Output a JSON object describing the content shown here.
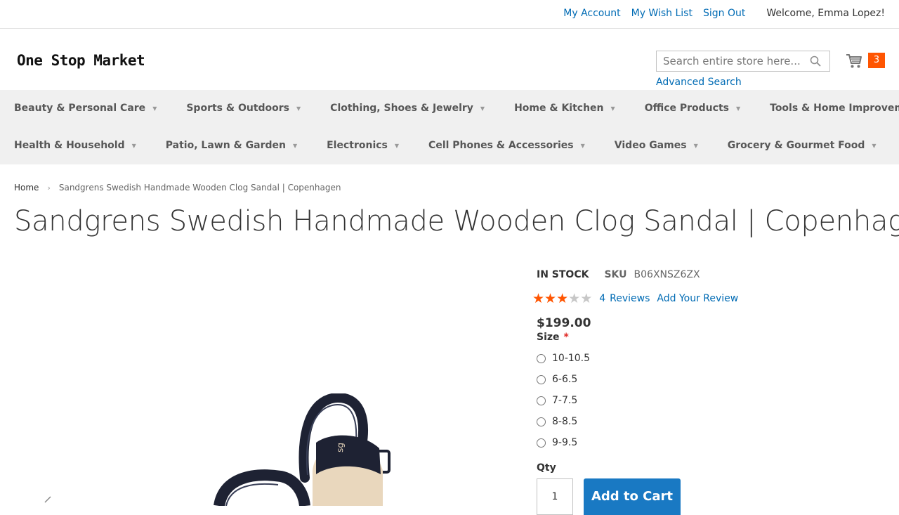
{
  "header": {
    "links": {
      "my_account": "My Account",
      "wish_list": "My Wish List",
      "sign_out": "Sign Out"
    },
    "welcome": "Welcome, Emma Lopez!",
    "logo": "One Stop Market",
    "search_placeholder": "Search entire store here...",
    "advanced_search": "Advanced Search",
    "cart_count": "3"
  },
  "nav": {
    "row1": [
      "Beauty & Personal Care",
      "Sports & Outdoors",
      "Clothing, Shoes & Jewelry",
      "Home & Kitchen",
      "Office Products",
      "Tools & Home Improvement"
    ],
    "row2": [
      "Health & Household",
      "Patio, Lawn & Garden",
      "Electronics",
      "Cell Phones & Accessories",
      "Video Games",
      "Grocery & Gourmet Food"
    ]
  },
  "breadcrumb": {
    "home": "Home",
    "current": "Sandgrens Swedish Handmade Wooden Clog Sandal | Copenhagen"
  },
  "product": {
    "title": "Sandgrens Swedish Handmade Wooden Clog Sandal | Copenhagen",
    "stock": "IN STOCK",
    "sku_label": "SKU",
    "sku": "B06XNSZ6ZX",
    "rating_stars": 3,
    "rating_max": 5,
    "review_count": "4",
    "reviews_label": "Reviews",
    "add_review": "Add Your Review",
    "price": "$199.00",
    "size_label": "Size",
    "size_required": "*",
    "sizes": [
      "10-10.5",
      "6-6.5",
      "7-7.5",
      "8-8.5",
      "9-9.5"
    ],
    "qty_label": "Qty",
    "qty_value": "1",
    "add_to_cart": "Add to Cart"
  },
  "colors": {
    "link": "#006bb4",
    "accent": "#ff5501",
    "button": "#1979c3",
    "star_on": "#ff5501",
    "star_off": "#c7c7c7"
  }
}
